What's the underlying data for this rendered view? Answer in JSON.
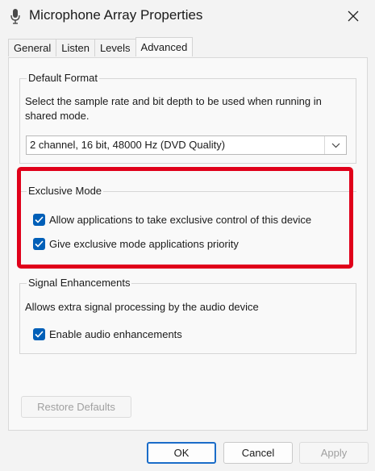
{
  "window": {
    "title": "Microphone Array Properties"
  },
  "tabs": [
    {
      "label": "General"
    },
    {
      "label": "Listen"
    },
    {
      "label": "Levels"
    },
    {
      "label": "Advanced"
    }
  ],
  "default_format": {
    "title": "Default Format",
    "description": "Select the sample rate and bit depth to be used when running in shared mode.",
    "selected_value": "2 channel, 16 bit, 48000 Hz (DVD Quality)"
  },
  "exclusive_mode": {
    "title": "Exclusive Mode",
    "option1": {
      "label": "Allow applications to take exclusive control of this device",
      "checked": true
    },
    "option2": {
      "label": "Give exclusive mode applications priority",
      "checked": true
    }
  },
  "signal_enhancements": {
    "title": "Signal Enhancements",
    "description": "Allows extra signal processing by the audio device",
    "option": {
      "label": "Enable audio enhancements",
      "checked": true
    }
  },
  "buttons": {
    "restore_defaults": "Restore Defaults",
    "ok": "OK",
    "cancel": "Cancel",
    "apply": "Apply"
  },
  "colors": {
    "accent": "#005fb8",
    "highlight": "#e0001a"
  }
}
